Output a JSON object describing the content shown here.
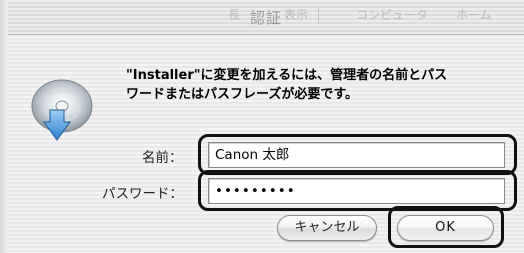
{
  "window": {
    "title": "認証",
    "ghost_titles": [
      "表示",
      "コンピュータ",
      "ホーム"
    ]
  },
  "dialog": {
    "message_line1": "\"Installer\"に変更を加えるには、管理者の名前とパス",
    "message_line2": "ワードまたはパスフレーズが必要です。",
    "name_label": "名前：",
    "name_value": "Canon 太郎",
    "password_label": "パスワード：",
    "password_value": "•••••••••"
  },
  "buttons": {
    "cancel": "キャンセル",
    "ok": "OK"
  },
  "icons": {
    "installer": "installer-disc-arrow-icon"
  }
}
